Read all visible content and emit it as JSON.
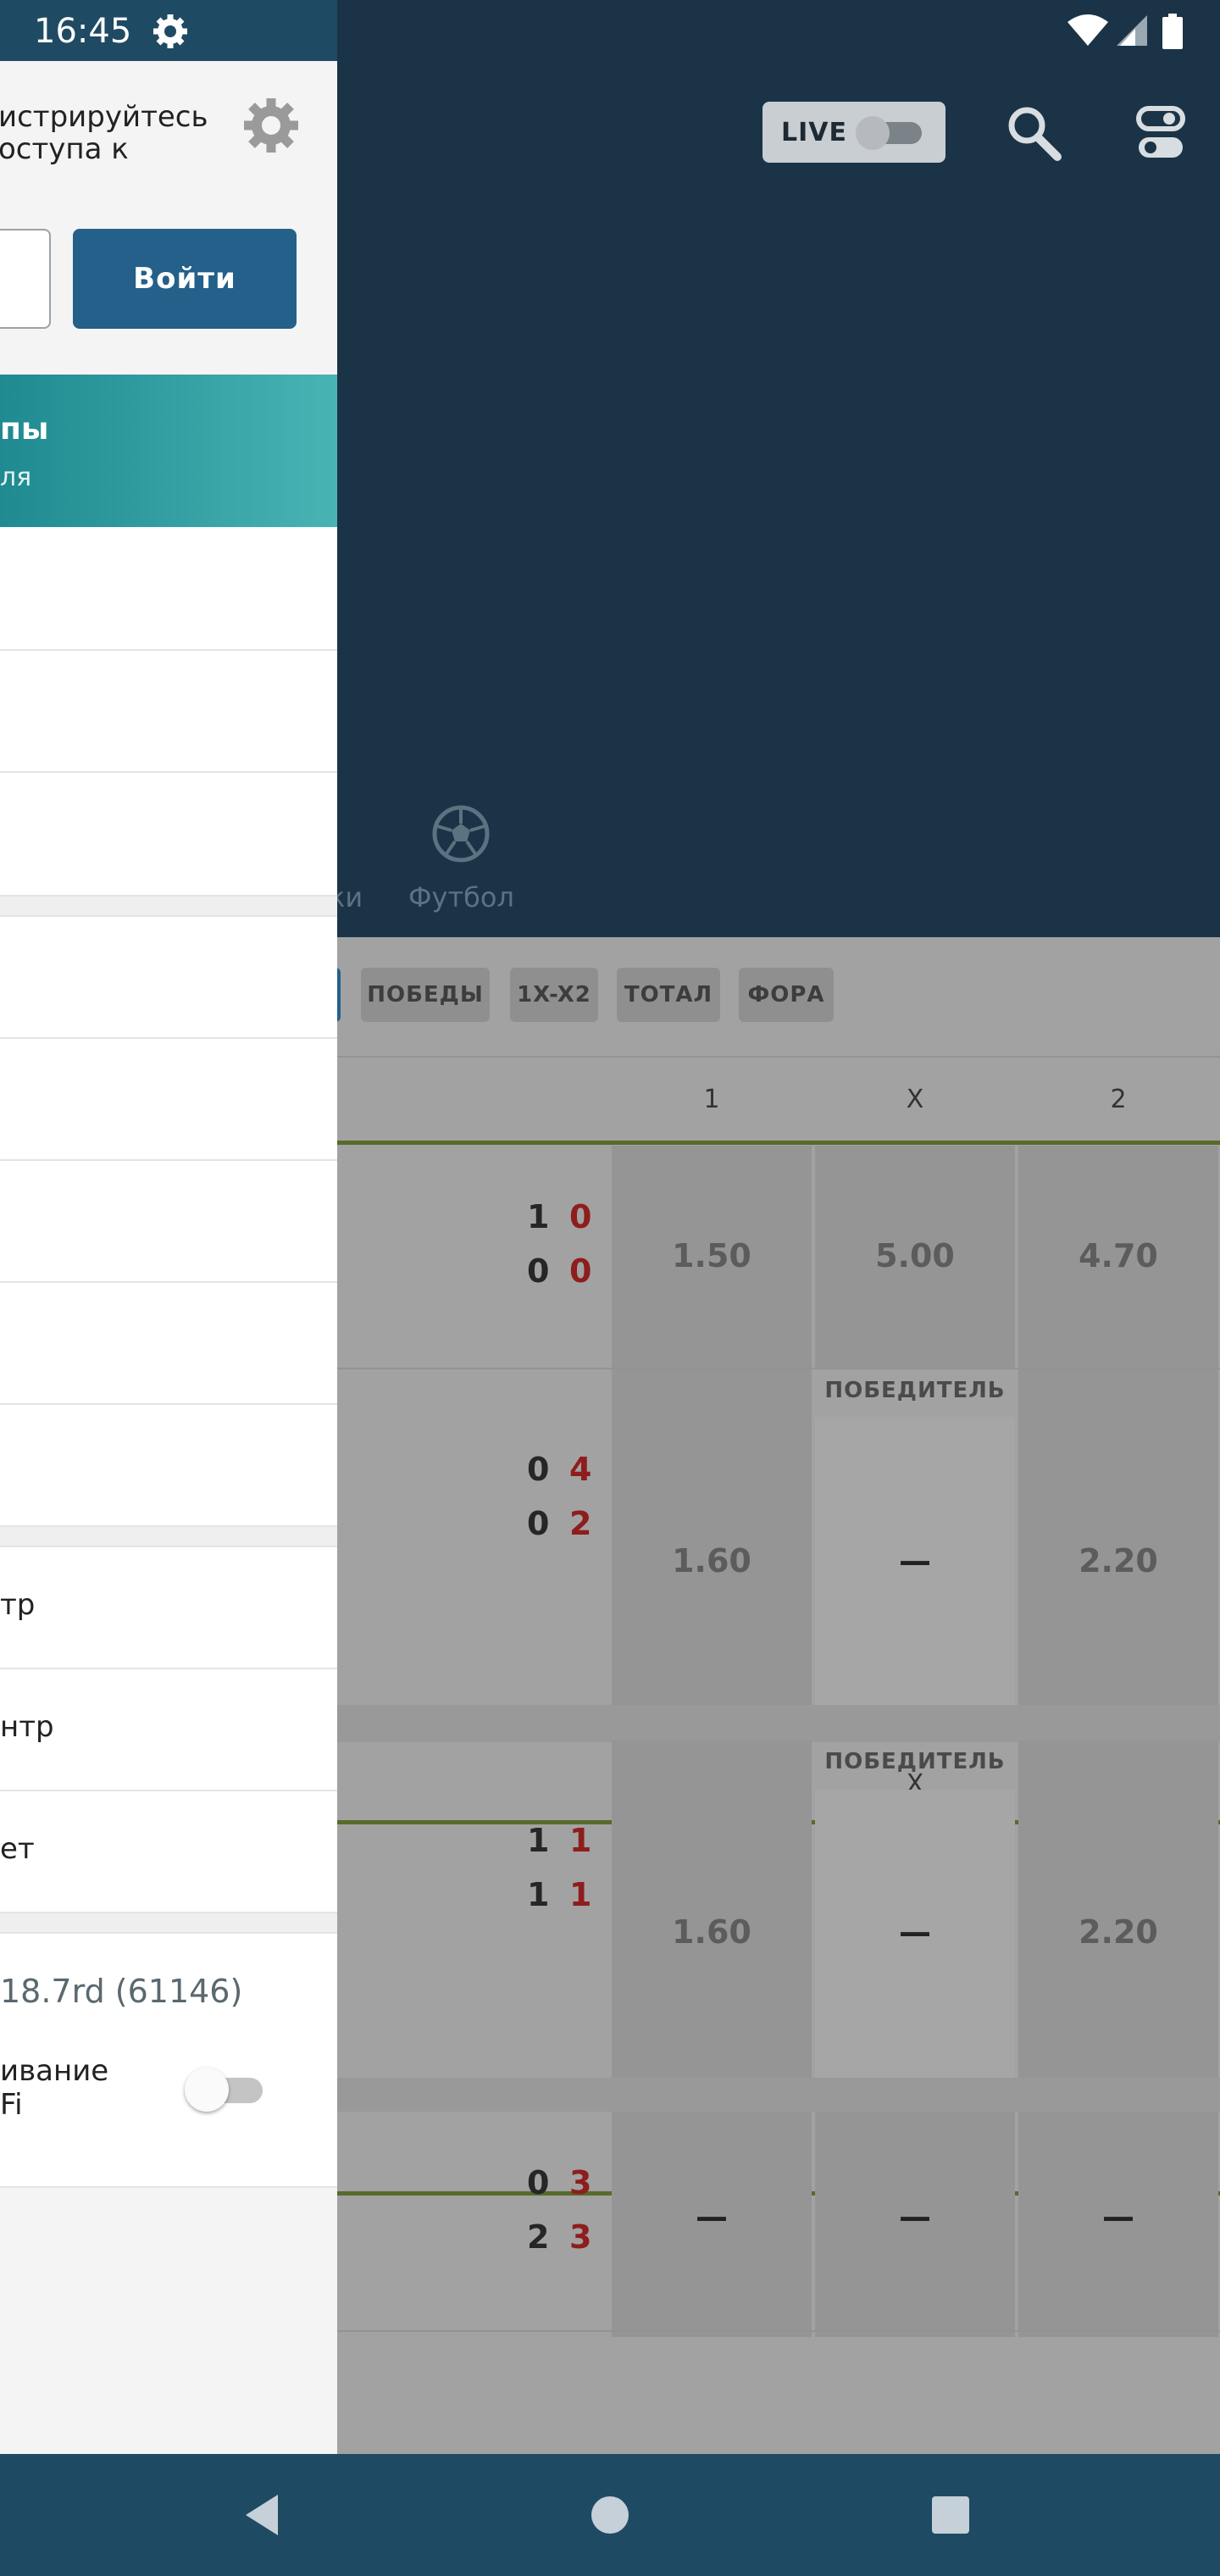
{
  "status_bar": {
    "time": "16:45",
    "icons": [
      "settings-icon",
      "wifi-icon",
      "signal-icon",
      "battery-icon"
    ]
  },
  "header": {
    "live_label": "LIVE",
    "live_toggle_on": false,
    "icons": [
      "search-icon",
      "filter-toggle-icon"
    ]
  },
  "sports_tabs": {
    "partial_label": "ки",
    "football_label": "Футбол"
  },
  "filter_chips": [
    "ПОБЕДЫ",
    "1X-X2",
    "ТОТАЛ",
    "ФОРА"
  ],
  "column_headers": [
    "1",
    "X",
    "2"
  ],
  "matches": [
    {
      "score_home": [
        "1",
        "0"
      ],
      "score_away": [
        "0",
        "0"
      ],
      "odds": [
        "1.50",
        "5.00",
        "4.70"
      ],
      "market": ""
    },
    {
      "score_home": [
        "0",
        "4"
      ],
      "score_away": [
        "0",
        "2"
      ],
      "odds": [
        "1.60",
        "—",
        "2.20"
      ],
      "market": "ПОБЕДИТЕЛЬ"
    },
    {
      "score_home": [
        "1",
        "1"
      ],
      "score_away": [
        "1",
        "1"
      ],
      "odds": [
        "1.60",
        "—",
        "2.20"
      ],
      "market": "ПОБЕДИТЕЛЬ"
    },
    {
      "score_home": [
        "0",
        "3"
      ],
      "score_away": [
        "2",
        "3"
      ],
      "odds": [
        "—",
        "—",
        "—"
      ],
      "market": ""
    }
  ],
  "drawer": {
    "register_line1": "истрируйтесь",
    "register_line2": "оступа к",
    "login_button": "Войти",
    "promo_title": "пы",
    "promo_sub": "ля",
    "menu_items_a": [
      "",
      "",
      ""
    ],
    "menu_items_b": [
      "",
      "",
      "",
      "",
      ""
    ],
    "menu_items_c": [
      "тр",
      "нтр",
      "ет"
    ],
    "version": "18.7rd (61146)",
    "wifi_line1": "ивание",
    "wifi_line2": "Fi",
    "wifi_toggle_on": false
  },
  "colors": {
    "header_bg": "#1a3347",
    "nav_bg": "#1f4a63",
    "accent_teal": "#48b4b4",
    "login_btn": "#24608a",
    "score_red": "#8e1d1d"
  }
}
